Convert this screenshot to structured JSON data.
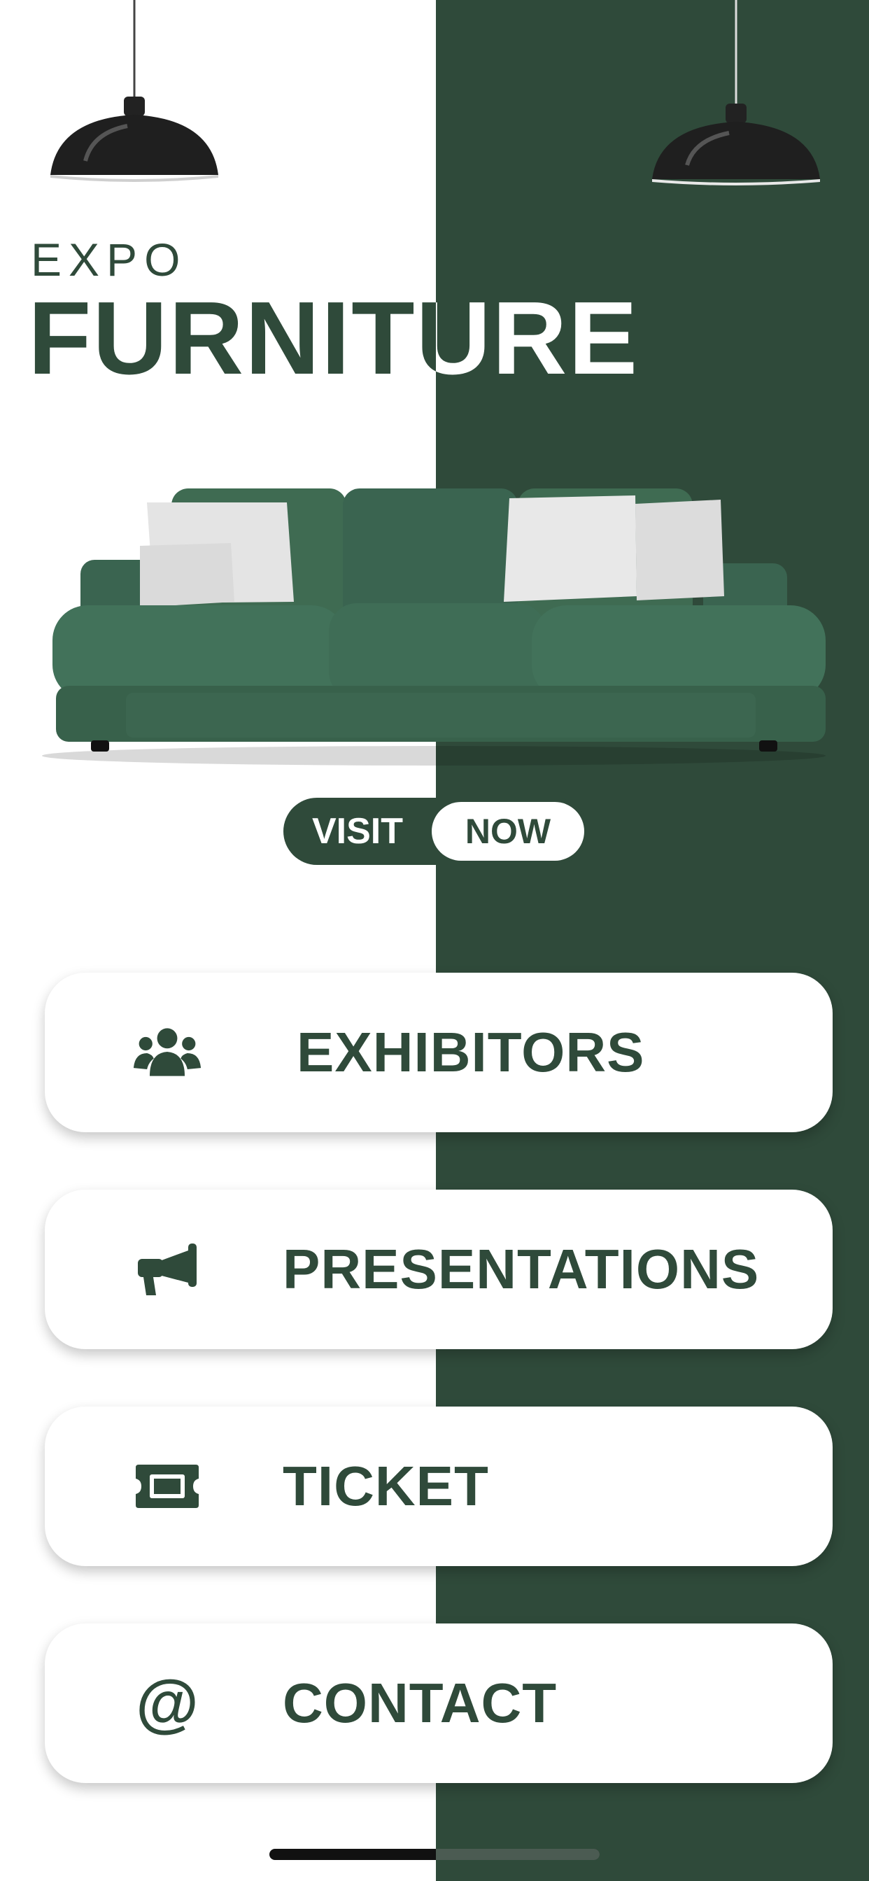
{
  "brand": {
    "pretitle": "EXPO",
    "title": "FURNITURE"
  },
  "cta": {
    "visit": "VISIT",
    "now": "NOW"
  },
  "menu": [
    {
      "label": "EXHIBITORS",
      "icon": "users-group-icon"
    },
    {
      "label": "PRESENTATIONS",
      "icon": "megaphone-icon"
    },
    {
      "label": "TICKET",
      "icon": "ticket-icon"
    },
    {
      "label": "CONTACT",
      "icon": "at-sign-icon"
    }
  ],
  "icons": {
    "at_sign": "@"
  },
  "colors": {
    "primary": "#2f4a3a",
    "background": "#ffffff",
    "sofa": "#3d6a50",
    "pillow": "#e6e6e6"
  }
}
